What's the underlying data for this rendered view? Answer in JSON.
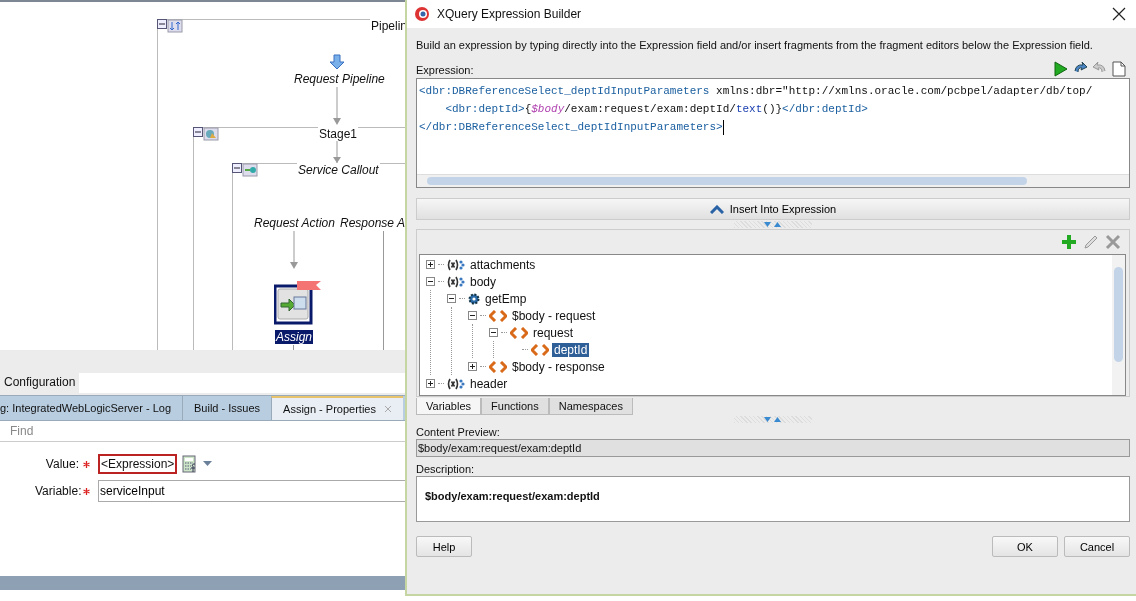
{
  "ide": {
    "diagram": {
      "pipeline": "Pipelin",
      "request_pipeline": "Request Pipeline",
      "stage": "Stage1",
      "service_callout": "Service Callout",
      "request_action": "Request Action",
      "response_action": "Response A",
      "assign_node": {
        "label": "Assign",
        "selected": true
      }
    },
    "editor_tab": "Configuration",
    "panel_tabs": [
      {
        "label": "g: IntegratedWebLogicServer - Log",
        "selected": false,
        "closable": false
      },
      {
        "label": "Build - Issues",
        "selected": false,
        "closable": false
      },
      {
        "label": "Assign - Properties",
        "selected": true,
        "closable": true
      }
    ],
    "find": {
      "placeholder": "Find"
    },
    "properties": [
      {
        "label": "Value:",
        "required": true,
        "kind": "expression",
        "value": "<Expression>"
      },
      {
        "label": "Variable:",
        "required": true,
        "kind": "text",
        "value": "serviceInput"
      }
    ]
  },
  "dialog": {
    "title": "XQuery Expression Builder",
    "instructions": "Build an expression by typing directly into the Expression field and/or insert fragments from the fragment editors below the Expression field.",
    "expression": {
      "label": "Expression:",
      "lines": [
        {
          "tokens": [
            {
              "kind": "tag",
              "text": "<dbr:DBReferenceSelect_deptIdInputParameters"
            },
            {
              "kind": "plain",
              "text": " xmlns:dbr=\"http://xmlns.oracle.com/pcbpel/adapter/db/top/"
            }
          ]
        },
        {
          "tokens": [
            {
              "kind": "tag",
              "text": "    <dbr:deptId>"
            },
            {
              "kind": "plain",
              "text": "{"
            },
            {
              "kind": "var",
              "text": "$body"
            },
            {
              "kind": "plain",
              "text": "/exam:request/exam:deptId/"
            },
            {
              "kind": "func",
              "text": "text"
            },
            {
              "kind": "plain",
              "text": "()}"
            },
            {
              "kind": "tag",
              "text": "</dbr:deptId>"
            }
          ]
        },
        {
          "tokens": [
            {
              "kind": "tag",
              "text": "</dbr:DBReferenceSelect_deptIdInputParameters>"
            }
          ]
        }
      ]
    },
    "insert_button": "Insert Into Expression",
    "tree": [
      {
        "label": "attachments",
        "kind": "variable",
        "expanded": false,
        "selected": false
      },
      {
        "label": "body",
        "kind": "variable",
        "expanded": true,
        "selected": false,
        "children": [
          {
            "label": "getEmp",
            "kind": "operation",
            "expanded": true,
            "selected": false,
            "children": [
              {
                "label": "$body - request",
                "kind": "element",
                "expanded": true,
                "selected": false,
                "children": [
                  {
                    "label": "request",
                    "kind": "element",
                    "expanded": true,
                    "selected": false,
                    "children": [
                      {
                        "label": "deptId",
                        "kind": "element",
                        "selected": true
                      }
                    ]
                  }
                ]
              },
              {
                "label": "$body - response",
                "kind": "element",
                "expanded": false,
                "selected": false
              }
            ]
          }
        ]
      },
      {
        "label": "header",
        "kind": "variable",
        "expanded": false,
        "selected": false
      }
    ],
    "tabs": [
      {
        "label": "Variables",
        "selected": true
      },
      {
        "label": "Functions",
        "selected": false
      },
      {
        "label": "Namespaces",
        "selected": false
      }
    ],
    "content_preview": {
      "label": "Content Preview:",
      "value": "$body/exam:request/exam:deptId"
    },
    "description": {
      "label": "Description:",
      "text": "$body/exam:request/exam:deptId"
    },
    "buttons": [
      {
        "label": "Help",
        "kind": "help"
      },
      {
        "label": "OK",
        "kind": "confirm"
      },
      {
        "label": "Cancel",
        "kind": "cancel"
      }
    ]
  }
}
